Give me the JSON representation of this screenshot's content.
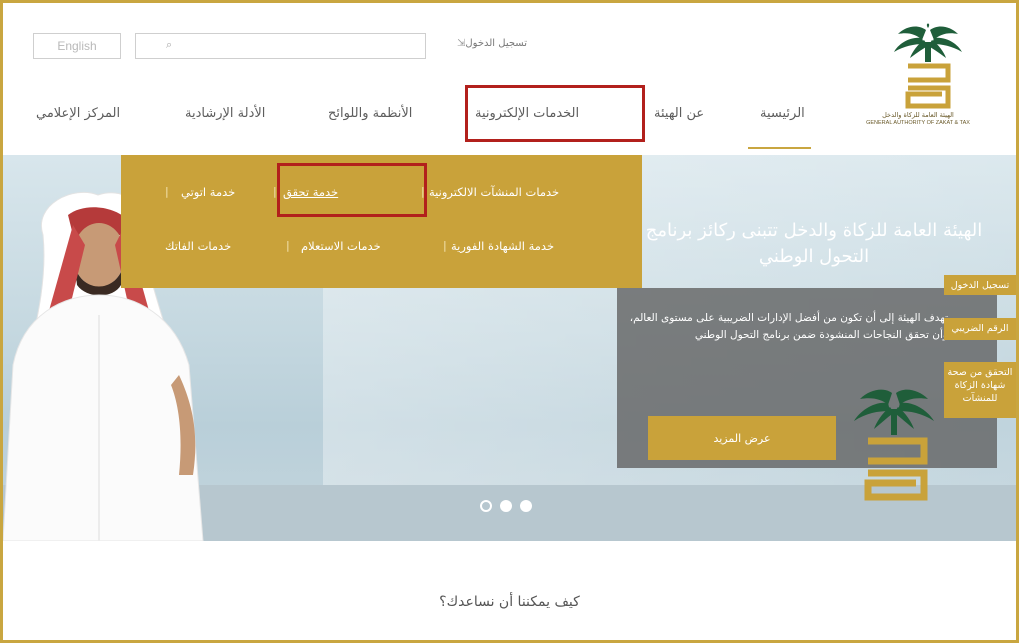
{
  "header": {
    "lang_button": "English",
    "search_placeholder": "",
    "login_link": "تسجيل الدخول",
    "logo_tagline_ar": "الهيئة العامة للزكاة والدخل",
    "logo_tagline_en": "GENERAL AUTHORITY OF ZAKAT & TAX"
  },
  "nav": {
    "items": [
      {
        "label": "الرئيسية"
      },
      {
        "label": "عن الهيئة"
      },
      {
        "label": "الخدمات الإلكترونية"
      },
      {
        "label": "الأنظمة واللوائح"
      },
      {
        "label": "الأدلة الإرشادية"
      },
      {
        "label": "المركز الإعلامي"
      }
    ]
  },
  "dropdown": {
    "row1": [
      "خدمات المنشآت الالكترونية",
      "خدمة تحقق",
      "خدمة اتوتي"
    ],
    "row2": [
      "خدمة الشهادة الفورية",
      "خدمات الاستعلام",
      "خدمات الفاتك"
    ]
  },
  "hero": {
    "title": "الهيئة العامة للزكاة والدخل تتبنى ركائز برنامج التحول الوطني",
    "description": "تهدف الهيئة إلى أن تكون من أفضل الإدارات الضريبية على مستوى العالم، وأن تحقق النجاحات المنشودة ضمن برنامج التحول الوطني",
    "more_button": "عرض المزيد",
    "slide_count": 3,
    "active_slide": 1
  },
  "side_tabs": [
    {
      "label": "تسجيل الدخول"
    },
    {
      "label": "الرقم الضريبي"
    },
    {
      "label": "التحقق من صحة شهادة الزكاة للمنشآت"
    }
  ],
  "help": {
    "title": "كيف يمكننا أن نساعدك؟"
  },
  "colors": {
    "accent_gold": "#c9a23a",
    "highlight_red": "#b2201c",
    "nav_text": "#5d5d5d",
    "logo_green": "#1f5e3a"
  },
  "icons": {
    "search": "search-icon",
    "login": "login-icon",
    "logo": "zakat-logo"
  }
}
